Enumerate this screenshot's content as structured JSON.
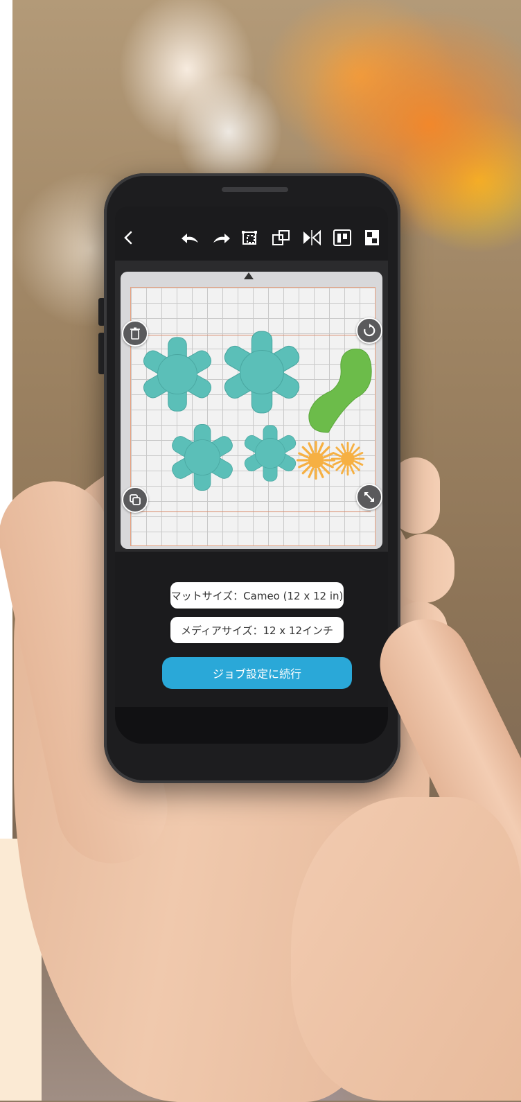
{
  "app": {
    "back_icon": "chevron-left-icon",
    "toolbar_icons": [
      "undo-icon",
      "redo-icon",
      "group-icon",
      "ungroup-icon",
      "mirror-icon",
      "align-icon",
      "layer-icon"
    ]
  },
  "mat": {
    "controls": [
      "trash-icon",
      "rotate-icon",
      "duplicate-icon",
      "resize-icon"
    ],
    "shape_colors": {
      "teal": "#5bbfb8",
      "green": "#6cbc4a",
      "orange": "#f6b043"
    }
  },
  "info": {
    "mat_size": "マットサイズ：Cameo (12 x 12 in)",
    "media_size": "メディアサイズ：12 x 12インチ"
  },
  "actions": {
    "continue_label": "ジョブ設定に続行"
  },
  "colors": {
    "accent": "#2aa8d8",
    "cutline": "#d88a6a"
  }
}
